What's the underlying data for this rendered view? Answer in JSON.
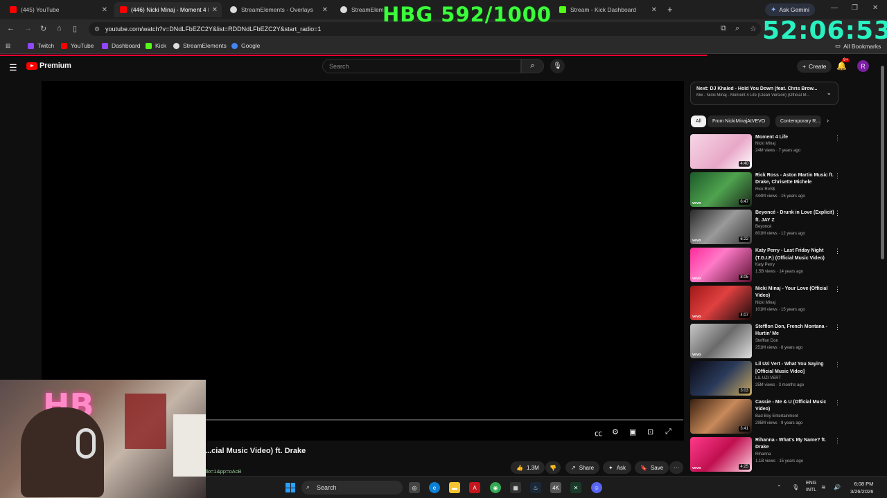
{
  "browser": {
    "tabs": [
      {
        "label": "(445) YouTube",
        "color": "#ff0000"
      },
      {
        "label": "(446) Nicki Minaj - Moment 4 L",
        "color": "#ff0000"
      },
      {
        "label": "StreamElements - Overlays",
        "color": "#ffffff"
      },
      {
        "label": "StreamElem...",
        "color": "#ffffff"
      },
      {
        "label": "Stream - Kick Dashboard",
        "color": "#53fc18"
      }
    ],
    "active_tab_index": 1,
    "ask_gemini": "Ask Gemini",
    "url": "youtube.com/watch?v=DNdLFbEZC2Y&list=RDDNdLFbEZC2Y&start_radio=1",
    "bookmarks": [
      {
        "label": "Twitch",
        "color": "#9146ff"
      },
      {
        "label": "YouTube",
        "color": "#ff0000"
      },
      {
        "label": "Dashboard",
        "color": "#9146ff"
      },
      {
        "label": "Kick",
        "color": "#53fc18"
      },
      {
        "label": "StreamElements",
        "color": "#dddddd"
      },
      {
        "label": "Google",
        "color": "#4285f4"
      }
    ],
    "all_bookmarks": "All Bookmarks"
  },
  "overlay": {
    "hbg_counter": "HBG 592/1000",
    "timer": "52:06:53",
    "webcam_sign": "HB"
  },
  "youtube": {
    "logo": "Premium",
    "search_placeholder": "Search",
    "create_label": "Create",
    "notif_badge": "9+",
    "avatar_letter": "R",
    "video_title": "...cial Music Video) ft. Drake",
    "url_fragment": "adio=1&pp=oAcB",
    "actions": {
      "likes": "1.3M",
      "share": "Share",
      "ask": "Ask",
      "save": "Save"
    },
    "up_next": {
      "title": "Next: DJ Khaled - Hold You Down (feat. Chris Brow...",
      "subtitle": "Mix - Nicki Minaj - Moment 4 Life (Clean Version) (Official M..."
    },
    "chips": [
      "All",
      "From NickiMinajAtVEVO",
      "Contemporary R..."
    ],
    "recommendations": [
      {
        "title": "Moment 4 Life",
        "channel": "Nicki Minaj",
        "meta": "24M views · 7 years ago",
        "duration": "4:40",
        "thumb": "linear-gradient(135deg,#f6d6e6,#e8a8c8 60%,#fff)",
        "vevo": ""
      },
      {
        "title": "Rick Ross - Aston Martin Music ft. Drake, Chrisette Michele",
        "channel": "Rick RoS$",
        "meta": "444M views · 15 years ago",
        "duration": "6:47",
        "thumb": "linear-gradient(135deg,#1d5a2a,#4fa34f 50%,#1a2a1a)",
        "vevo": "vevo"
      },
      {
        "title": "Beyoncé - Drunk in Love (Explicit) ft. JAY Z",
        "channel": "Beyoncé",
        "meta": "801M views · 12 years ago",
        "duration": "6:22",
        "thumb": "linear-gradient(135deg,#2a2a2a,#9a9a9a 50%,#3a3a3a)",
        "vevo": "vevo"
      },
      {
        "title": "Katy Perry - Last Friday Night (T.G.I.F.) (Official Music Video)",
        "channel": "Katy Perry",
        "meta": "1.5B views · 14 years ago",
        "duration": "8:05",
        "thumb": "linear-gradient(135deg,#ff2a9a,#ff7ac8 40%,#5a1030)",
        "vevo": "vevo"
      },
      {
        "title": "Nicki Minaj - Your Love (Official Video)",
        "channel": "Nicki Minaj",
        "meta": "101M views · 15 years ago",
        "duration": "4:07",
        "thumb": "linear-gradient(135deg,#a01818,#e04040 45%,#1a0a0a)",
        "vevo": "vevo"
      },
      {
        "title": "Stefflon Don, French Montana - Hurtin' Me",
        "channel": "Stefflon Don",
        "meta": "251M views · 8 years ago",
        "duration": "",
        "thumb": "linear-gradient(135deg,#c8c8c8,#6a6a6a 50%,#e0e0e0)",
        "vevo": "vevo"
      },
      {
        "title": "Lil Uzi Vert - What You Saying [Official Music Video]",
        "channel": "LIL UZI VERT",
        "meta": "25M views · 3 months ago",
        "duration": "3:03",
        "thumb": "linear-gradient(135deg,#0a0a14,#2a3a5a 50%,#c8a860)",
        "vevo": ""
      },
      {
        "title": "Cassie - Me & U (Official Music Video)",
        "channel": "Bad Boy Entertainment",
        "meta": "295M views · 9 years ago",
        "duration": "3:41",
        "thumb": "linear-gradient(135deg,#3a2010,#c88a5a 50%,#1a1010)",
        "vevo": ""
      },
      {
        "title": "Rihanna - What's My Name? ft. Drake",
        "channel": "Rihanna",
        "meta": "1.1B views · 15 years ago",
        "duration": "4:25",
        "thumb": "linear-gradient(135deg,#ff3a8a,#c01050 50%,#ffd0e0)",
        "vevo": "vevo"
      }
    ]
  },
  "taskbar": {
    "search": "Search",
    "lang_top": "ENG",
    "lang_bottom": "INTL",
    "time": "6:08 PM",
    "date": "3/26/2026"
  }
}
